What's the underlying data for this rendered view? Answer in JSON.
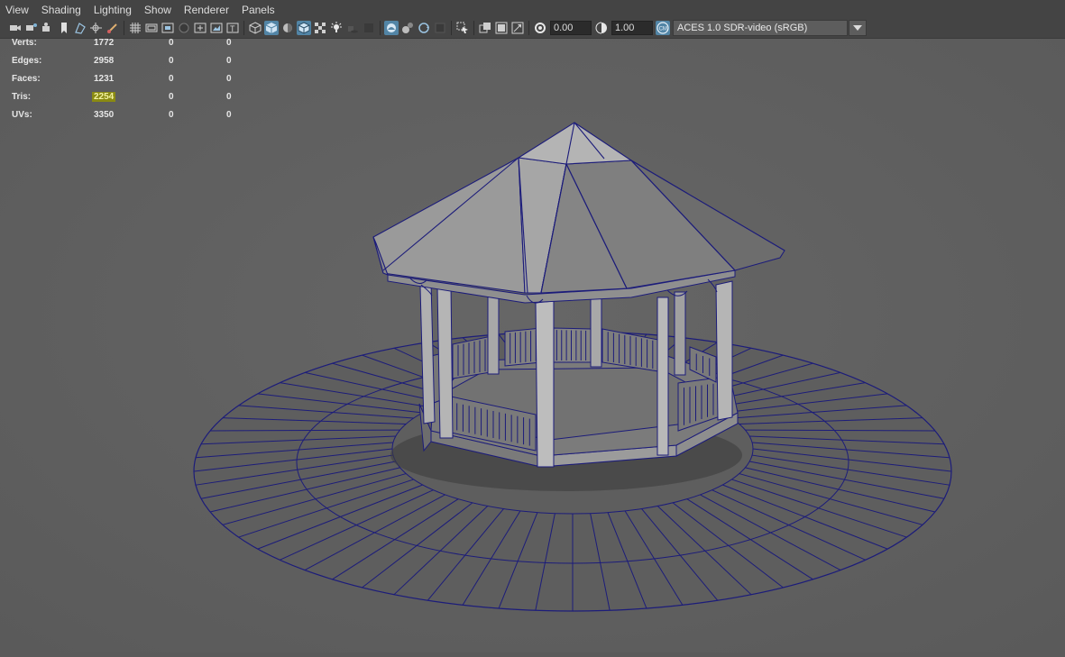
{
  "menu": [
    "View",
    "Shading",
    "Lighting",
    "Show",
    "Renderer",
    "Panels"
  ],
  "toolbar": {
    "exposure_value": "0.00",
    "gamma_value": "1.00",
    "color_space": "ACES 1.0 SDR-video (sRGB)"
  },
  "hud": {
    "rows": [
      {
        "label": "Verts:",
        "v1": "1772",
        "v2": "0",
        "v3": "0"
      },
      {
        "label": "Edges:",
        "v1": "2958",
        "v2": "0",
        "v3": "0"
      },
      {
        "label": "Faces:",
        "v1": "1231",
        "v2": "0",
        "v3": "0"
      },
      {
        "label": "Tris:",
        "v1": "2254",
        "v2": "0",
        "v3": "0"
      },
      {
        "label": "UVs:",
        "v1": "3350",
        "v2": "0",
        "v3": "0"
      }
    ]
  },
  "icons": [
    "camera-icon",
    "camera-attributes-icon",
    "bookmark-icon",
    "image-plane-icon",
    "grease-pencil-icon",
    "grid-icon",
    "film-gate-icon",
    "resolution-gate-icon",
    "gate-mask-icon",
    "field-chart-icon",
    "safe-action-icon",
    "safe-title-icon",
    "wireframe-icon",
    "smooth-shade-icon",
    "default-material-icon",
    "wireframe-on-shaded-icon",
    "textured-icon",
    "use-all-lights-icon",
    "shadows-icon",
    "screen-space-ao-icon",
    "motion-blur-icon",
    "anti-aliasing-icon",
    "depth-of-field-icon",
    "isolate-select-icon",
    "xray-icon",
    "xray-joints-icon",
    "backface-culling-icon",
    "exposure-icon",
    "gamma-icon",
    "color-management-icon"
  ]
}
